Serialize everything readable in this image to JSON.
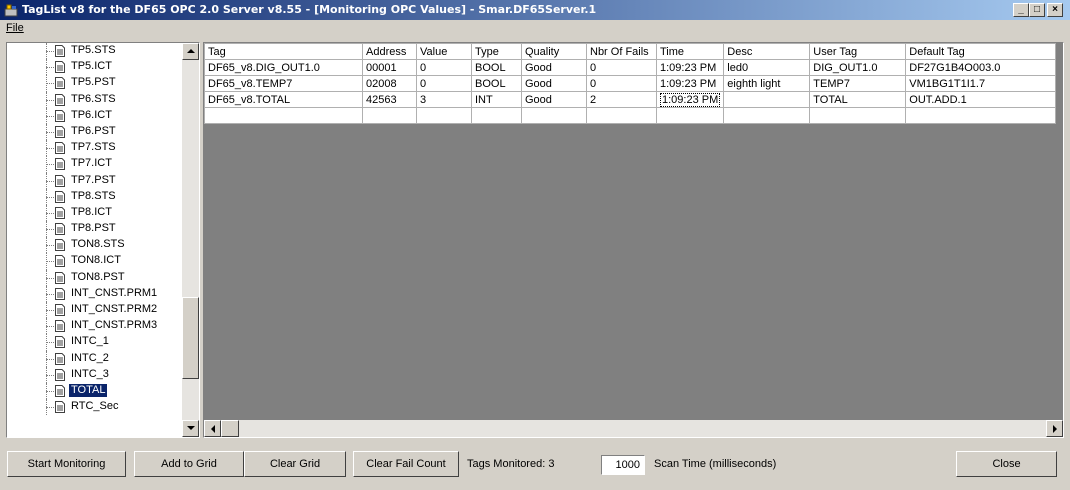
{
  "window": {
    "title": "TagList v8 for the DF65 OPC 2.0 Server v8.55 - [Monitoring OPC Values] - Smar.DF65Server.1",
    "buttons": {
      "minimize": "_",
      "maximize": "□",
      "close": "×"
    }
  },
  "menu": {
    "file": "File"
  },
  "tree": {
    "items": [
      {
        "label": "TP5.STS"
      },
      {
        "label": "TP5.ICT"
      },
      {
        "label": "TP5.PST"
      },
      {
        "label": "TP6.STS"
      },
      {
        "label": "TP6.ICT"
      },
      {
        "label": "TP6.PST"
      },
      {
        "label": "TP7.STS"
      },
      {
        "label": "TP7.ICT"
      },
      {
        "label": "TP7.PST"
      },
      {
        "label": "TP8.STS"
      },
      {
        "label": "TP8.ICT"
      },
      {
        "label": "TP8.PST"
      },
      {
        "label": "TON8.STS"
      },
      {
        "label": "TON8.ICT"
      },
      {
        "label": "TON8.PST"
      },
      {
        "label": "INT_CNST.PRM1"
      },
      {
        "label": "INT_CNST.PRM2"
      },
      {
        "label": "INT_CNST.PRM3"
      },
      {
        "label": "INTC_1"
      },
      {
        "label": "INTC_2"
      },
      {
        "label": "INTC_3"
      },
      {
        "label": "TOTAL",
        "selected": true
      },
      {
        "label": "RTC_Sec"
      }
    ]
  },
  "grid": {
    "columns": [
      "Tag",
      "Address",
      "Value",
      "Type",
      "Quality",
      "Nbr Of Fails",
      "Time",
      "Desc",
      "User Tag",
      "Default Tag"
    ],
    "rows": [
      [
        "DF65_v8.DIG_OUT1.0",
        "00001",
        "0",
        "BOOL",
        "Good",
        "0",
        "1:09:23 PM",
        "led0",
        "DIG_OUT1.0",
        "DF27G1B4O003.0"
      ],
      [
        "DF65_v8.TEMP7",
        "02008",
        "0",
        "BOOL",
        "Good",
        "0",
        "1:09:23 PM",
        "eighth light",
        "TEMP7",
        "VM1BG1T1I1.7"
      ],
      [
        "DF65_v8.TOTAL",
        "42563",
        "3",
        "INT",
        "Good",
        "2",
        "1:09:23 PM",
        "",
        "TOTAL",
        "OUT.ADD.1"
      ],
      [
        "",
        "",
        "",
        "",
        "",
        "",
        "",
        "",
        "",
        ""
      ]
    ]
  },
  "footer": {
    "start_monitoring": "Start Monitoring",
    "add_to_grid": "Add to Grid",
    "clear_grid": "Clear Grid",
    "clear_fail_count": "Clear Fail Count",
    "tags_monitored": "Tags Monitored: 3",
    "scan_time_value": "1000",
    "scan_time_label": "Scan Time (milliseconds)",
    "close": "Close"
  },
  "colors": {
    "title_active": "#0a246a",
    "selection": "#0a246a",
    "face": "#d4d0c8"
  }
}
